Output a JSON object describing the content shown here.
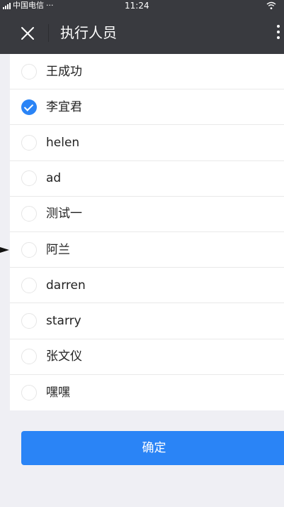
{
  "status_bar": {
    "carrier": "中国电信",
    "more": "···",
    "time": "11:24"
  },
  "nav": {
    "title": "执行人员"
  },
  "people": [
    {
      "name": "王成功",
      "checked": false
    },
    {
      "name": "李宜君",
      "checked": true
    },
    {
      "name": "helen",
      "checked": false
    },
    {
      "name": "ad",
      "checked": false
    },
    {
      "name": "测试一",
      "checked": false
    },
    {
      "name": "阿兰",
      "checked": false
    },
    {
      "name": "darren",
      "checked": false
    },
    {
      "name": "starry",
      "checked": false
    },
    {
      "name": "张文仪",
      "checked": false
    },
    {
      "name": "嘿嘿",
      "checked": false
    }
  ],
  "confirm_label": "确定",
  "colors": {
    "nav_background": "#393a3f",
    "accent": "#2a84f6",
    "page_background": "#efeff4"
  },
  "icons": {
    "close": "close-icon",
    "menu": "more-vertical-icon",
    "checked": "check-icon",
    "signal": "signal-icon",
    "wifi": "wifi-icon"
  }
}
